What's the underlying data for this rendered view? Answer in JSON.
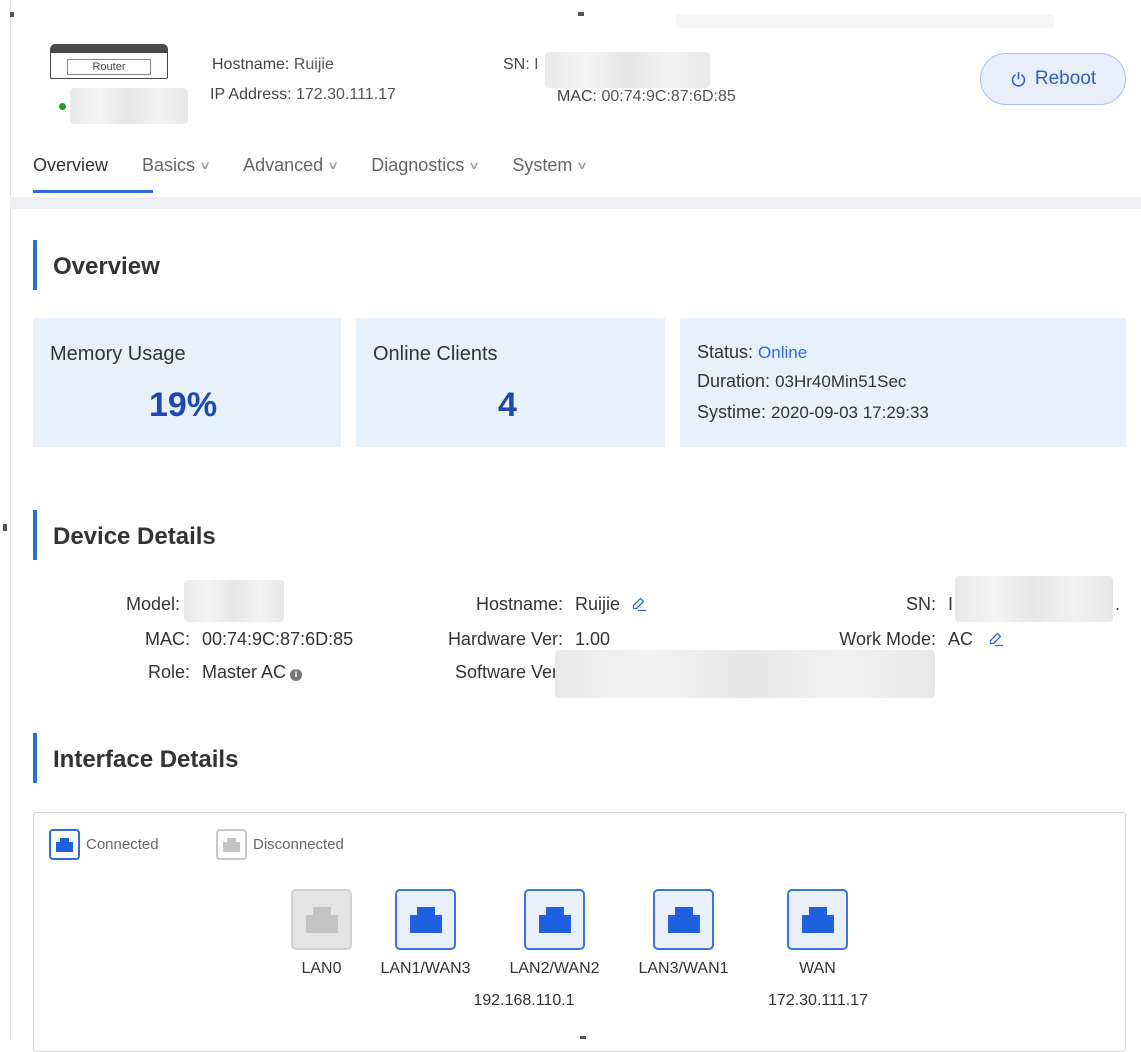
{
  "header": {
    "router_label": "Router",
    "hostname_label": "Hostname:",
    "hostname_value": "Ruijie",
    "ip_label": "IP Address:",
    "ip_value": "172.30.111.17",
    "sn_label": "SN:",
    "sn_value": "I",
    "mac_label": "MAC:",
    "mac_value": "00:74:9C:87:6D:85",
    "reboot_label": "Reboot",
    "status_color": "#2a9d2a"
  },
  "nav": {
    "tabs": [
      {
        "label": "Overview",
        "active": true
      },
      {
        "label": "Basics",
        "dropdown": true
      },
      {
        "label": "Advanced",
        "dropdown": true
      },
      {
        "label": "Diagnostics",
        "dropdown": true
      },
      {
        "label": "System",
        "dropdown": true
      }
    ]
  },
  "overview": {
    "title": "Overview",
    "memory": {
      "label": "Memory Usage",
      "value": "19%"
    },
    "clients": {
      "label": "Online Clients",
      "value": "4"
    },
    "status": {
      "status_label": "Status:",
      "status_value": "Online",
      "duration_label": "Duration:",
      "duration_value": "03Hr40Min51Sec",
      "systime_label": "Systime:",
      "systime_value": "2020-09-03 17:29:33"
    }
  },
  "device_details": {
    "title": "Device Details",
    "model_label": "Model:",
    "mac_label": "MAC:",
    "mac_value": "00:74:9C:87:6D:85",
    "role_label": "Role:",
    "role_value": "Master AC",
    "hostname_label": "Hostname:",
    "hostname_value": "Ruijie",
    "hardware_label": "Hardware Ver:",
    "hardware_value": "1.00",
    "software_label": "Software Ver:",
    "sn_label": "SN:",
    "sn_value": "I",
    "sn_tail": ".",
    "workmode_label": "Work Mode:",
    "workmode_value": "AC"
  },
  "interface_details": {
    "title": "Interface Details",
    "legend_connected": "Connected",
    "legend_disconnected": "Disconnected",
    "ports": [
      {
        "label": "LAN0",
        "connected": false,
        "ip": ""
      },
      {
        "label": "LAN1/WAN3",
        "connected": true,
        "ip": ""
      },
      {
        "label": "LAN2/WAN2",
        "connected": true,
        "ip": "192.168.110.1"
      },
      {
        "label": "LAN3/WAN1",
        "connected": true,
        "ip": ""
      },
      {
        "label": "WAN",
        "connected": true,
        "ip": "172.30.111.17"
      }
    ]
  },
  "colors": {
    "accent": "#2d6bd6",
    "card_bg": "#e6f1fb",
    "big_number": "#1f47b0",
    "port_disconnected": "#c3c3c3"
  }
}
